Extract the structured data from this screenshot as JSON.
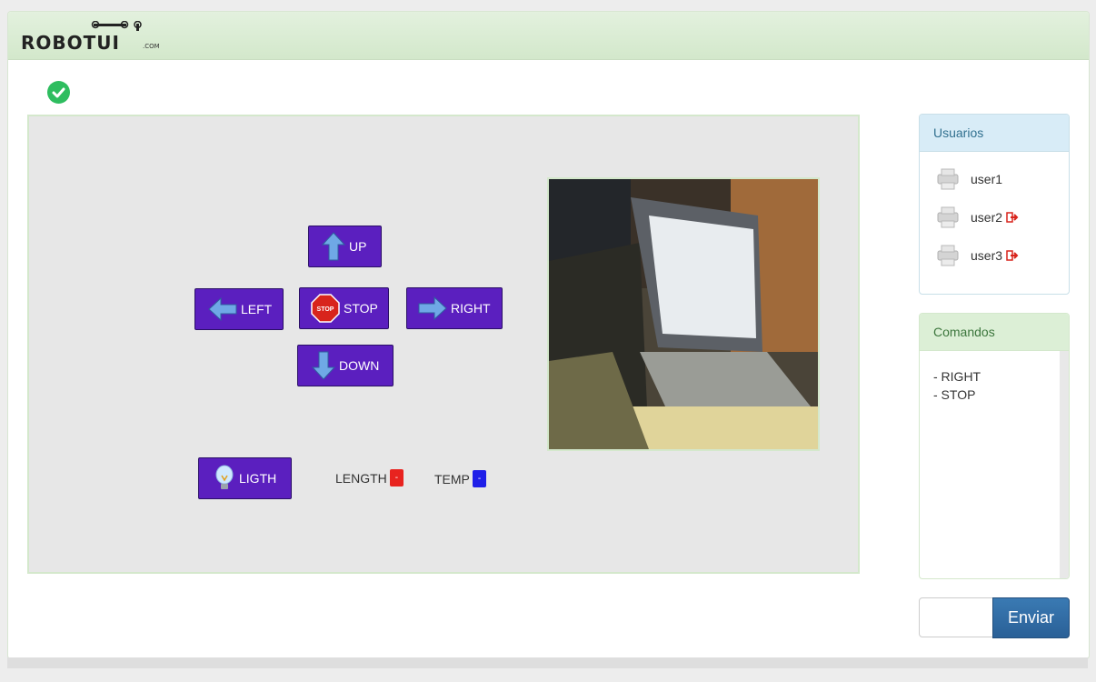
{
  "app": {
    "logo_text": "ROBOTUI",
    "logo_suffix": ".COM",
    "status_icon": "check-circle-icon"
  },
  "controls": {
    "up": {
      "label": "UP",
      "icon": "arrow-up-icon"
    },
    "left": {
      "label": "LEFT",
      "icon": "arrow-left-icon"
    },
    "stop": {
      "label": "STOP",
      "icon": "stop-sign-icon",
      "sign_text": "STOP"
    },
    "right": {
      "label": "RIGHT",
      "icon": "arrow-right-icon"
    },
    "down": {
      "label": "DOWN",
      "icon": "arrow-down-icon"
    },
    "light": {
      "label": "LIGTH",
      "icon": "lightbulb-icon"
    }
  },
  "sensors": {
    "length": {
      "label": "LENGTH",
      "value": "-",
      "color": "#e8231f"
    },
    "temp": {
      "label": "TEMP",
      "value": "-",
      "color": "#1f1fe8"
    }
  },
  "users_panel": {
    "title": "Usuarios",
    "users": [
      {
        "name": "user1",
        "logout": false
      },
      {
        "name": "user2",
        "logout": true
      },
      {
        "name": "user3",
        "logout": true
      }
    ]
  },
  "commands_panel": {
    "title": "Comandos",
    "items": [
      "- RIGHT",
      "- STOP"
    ]
  },
  "send": {
    "input_value": "",
    "button_label": "Enviar"
  },
  "colors": {
    "button_purple": "#5b1fbf",
    "accent_green": "#2ebd5f",
    "send_blue": "#2a6097"
  }
}
